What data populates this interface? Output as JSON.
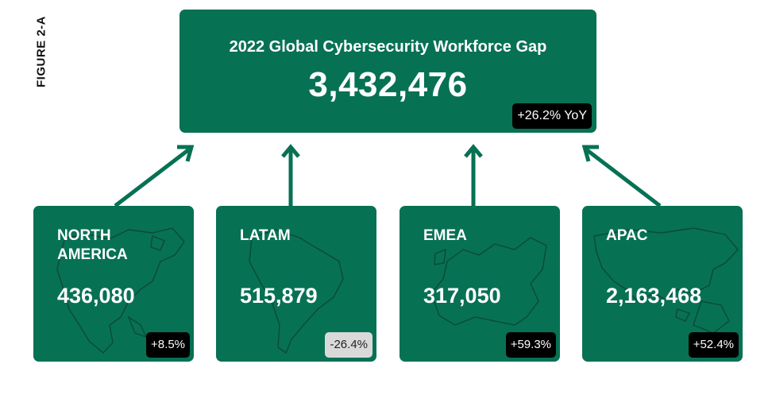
{
  "figure_label": "FIGURE 2-A",
  "total": {
    "title": "2022 Global Cybersecurity Workforce Gap",
    "value": "3,432,476",
    "change": "+26.2% YoY"
  },
  "regions": [
    {
      "name_line1": "NORTH",
      "name_line2": "AMERICA",
      "value": "436,080",
      "change": "+8.5%",
      "trend": "up",
      "map_icon": "north-america-map-icon"
    },
    {
      "name_line1": "LATAM",
      "name_line2": "",
      "value": "515,879",
      "change": "-26.4%",
      "trend": "down",
      "map_icon": "south-america-map-icon"
    },
    {
      "name_line1": "EMEA",
      "name_line2": "",
      "value": "317,050",
      "change": "+59.3%",
      "trend": "up",
      "map_icon": "europe-map-icon"
    },
    {
      "name_line1": "APAC",
      "name_line2": "",
      "value": "2,163,468",
      "change": "+52.4%",
      "trend": "up",
      "map_icon": "asia-pacific-map-icon"
    }
  ],
  "colors": {
    "box_green": "#077154",
    "arrow_green": "#077154",
    "badge_dark": "#000000",
    "badge_light": "#d9d9d9"
  }
}
